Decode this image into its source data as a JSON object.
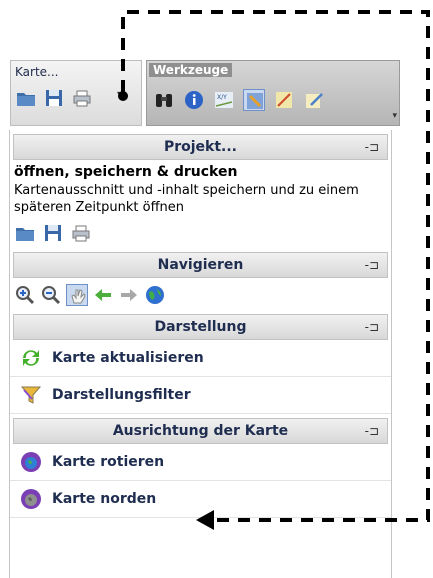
{
  "toolbar": {
    "karte_title": "Karte...",
    "werkzeuge_title": "Werkzeuge",
    "karte_icons": [
      "folder-icon",
      "save-icon",
      "print-icon"
    ],
    "werkzeuge_icons": [
      "binoculars-icon",
      "info-icon",
      "xy-coordinates-icon",
      "select-icon",
      "measure-icon",
      "edit-icon"
    ],
    "xy_label": "X/Y"
  },
  "panel": {
    "sections": [
      {
        "title": "Projekt...",
        "pin": "⊣⊏"
      },
      {
        "title": "Navigieren",
        "pin": "⊣⊏"
      },
      {
        "title": "Darstellung",
        "pin": "⊣⊏"
      },
      {
        "title": "Ausrichtung der Karte",
        "pin": "⊣⊏"
      }
    ],
    "projekt": {
      "heading": "öffnen, speichern & drucken",
      "description": "Kartenausschnitt und -inhalt speichern und zu einem späteren Zeitpunkt öffnen"
    },
    "darstellung_items": [
      "Karte aktualisieren",
      "Darstellungsfilter"
    ],
    "ausrichtung_items": [
      "Karte rotieren",
      "Karte norden"
    ]
  },
  "colors": {
    "header_text": "#1f2d50",
    "werkzeuge_bg": "#b5b5b5",
    "annotation": "#000000"
  }
}
